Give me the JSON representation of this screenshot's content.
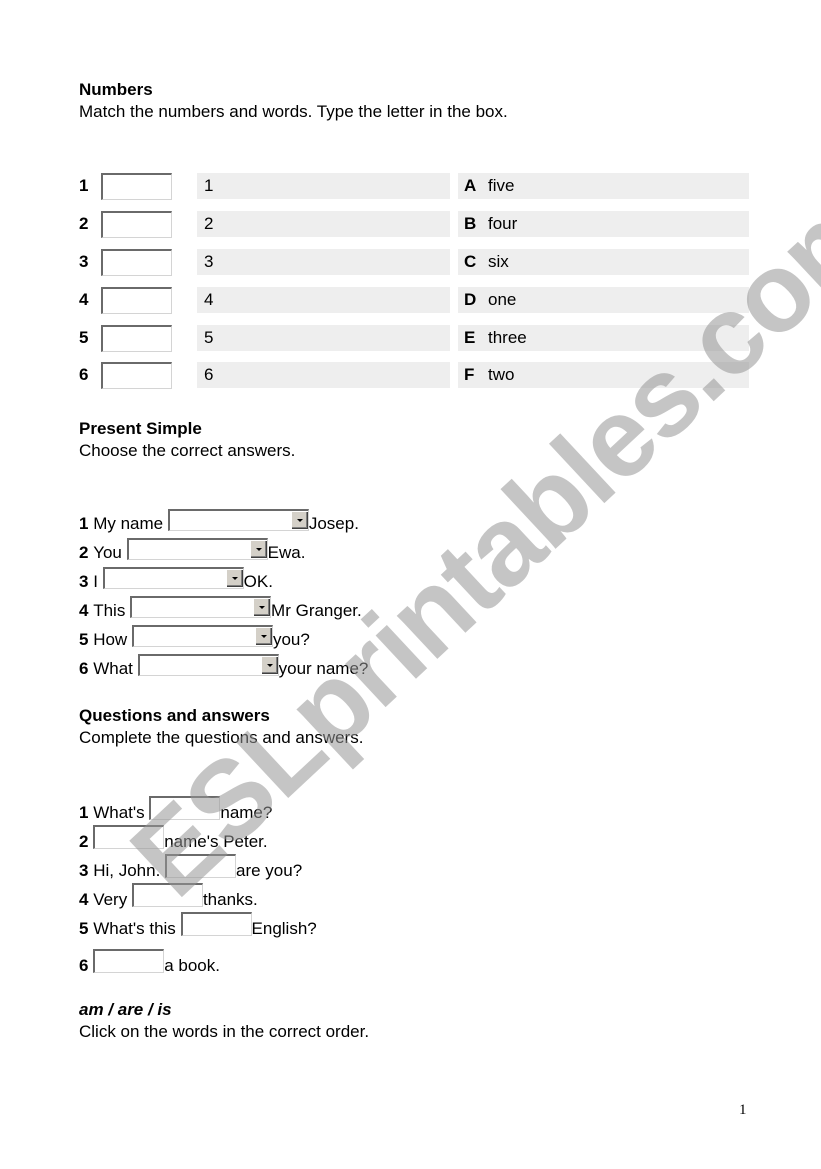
{
  "watermark": "ESLprintables.com",
  "numbers": {
    "title": "Numbers",
    "instruction": "Match the numbers and words. Type the letter in the box.",
    "rows": [
      {
        "n": "1",
        "value": "",
        "left": "1",
        "letter": "A",
        "word": "five"
      },
      {
        "n": "2",
        "value": "",
        "left": "2",
        "letter": "B",
        "word": "four"
      },
      {
        "n": "3",
        "value": "",
        "left": "3",
        "letter": "C",
        "word": "six"
      },
      {
        "n": "4",
        "value": "",
        "left": "4",
        "letter": "D",
        "word": "one"
      },
      {
        "n": "5",
        "value": "",
        "left": "5",
        "letter": "E",
        "word": "three"
      },
      {
        "n": "6",
        "value": "",
        "left": "6",
        "letter": "F",
        "word": "two"
      }
    ]
  },
  "present_simple": {
    "title": "Present Simple",
    "instruction": "Choose the correct answers.",
    "items": [
      {
        "n": "1",
        "before": "My name ",
        "selected": "",
        "after": "Josep."
      },
      {
        "n": "2",
        "before": "You ",
        "selected": "",
        "after": "Ewa."
      },
      {
        "n": "3",
        "before": "I ",
        "selected": "",
        "after": "OK."
      },
      {
        "n": "4",
        "before": "This ",
        "selected": "",
        "after": "Mr Granger."
      },
      {
        "n": "5",
        "before": "How ",
        "selected": "",
        "after": "you?"
      },
      {
        "n": "6",
        "before": "What ",
        "selected": "",
        "after": "your name?"
      }
    ]
  },
  "questions": {
    "title": "Questions and answers",
    "instruction": "Complete the questions and answers.",
    "items": [
      {
        "n": "1",
        "before": "What's ",
        "value": "",
        "after": "name?"
      },
      {
        "n": "2",
        "before": "",
        "value": "",
        "after": "name's Peter."
      },
      {
        "n": "3",
        "before": "Hi, John. ",
        "value": "",
        "after": "are you?"
      },
      {
        "n": "4",
        "before": "Very ",
        "value": "",
        "after": "thanks."
      },
      {
        "n": "5",
        "before": "What's this ",
        "value": "",
        "after": "English?"
      },
      {
        "n": "6",
        "before": "",
        "value": "",
        "after": "a book."
      }
    ]
  },
  "word_order": {
    "title": "am / are / is",
    "instruction": "Click on the words in the correct order."
  },
  "page_number": "1"
}
